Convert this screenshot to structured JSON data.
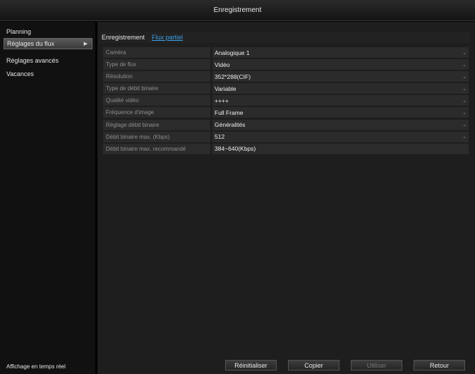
{
  "window": {
    "title": "Enregistrement"
  },
  "sidebar": {
    "items": [
      {
        "label": "Planning"
      },
      {
        "label": "Réglages du flux",
        "arrow": "▶"
      },
      {
        "label": "Réglages avancés"
      },
      {
        "label": "Vacances"
      }
    ],
    "bottom_label": "Affichage en temps réel"
  },
  "tabs": [
    {
      "label": "Enregistrement"
    },
    {
      "label": "Flux partiel"
    }
  ],
  "settings": [
    {
      "label": "Caméra",
      "value": "Analogique 1",
      "dropdown": true
    },
    {
      "label": "Type de flux",
      "value": "Vidéo",
      "dropdown": true
    },
    {
      "label": "Résolution",
      "value": "352*288(CIF)",
      "dropdown": true
    },
    {
      "label": "Type de débit binaire",
      "value": "Variable",
      "dropdown": true
    },
    {
      "label": "Qualité vidéo",
      "value": "++++",
      "dropdown": true
    },
    {
      "label": "Fréquence d'image",
      "value": "Full Frame",
      "dropdown": true
    },
    {
      "label": "Réglage débit binaire",
      "value": "Généralités",
      "dropdown": true
    },
    {
      "label": "Débit binaire max. (Kbps)",
      "value": "512",
      "dropdown": true
    },
    {
      "label": "Débit binaire max. recommandé",
      "value": "384~640(Kbps)",
      "dropdown": false
    }
  ],
  "dropdown_glyph": "⌄",
  "buttons": {
    "reset": "Réinitialiser",
    "copy": "Copier",
    "apply": "Utiliser",
    "back": "Retour"
  }
}
